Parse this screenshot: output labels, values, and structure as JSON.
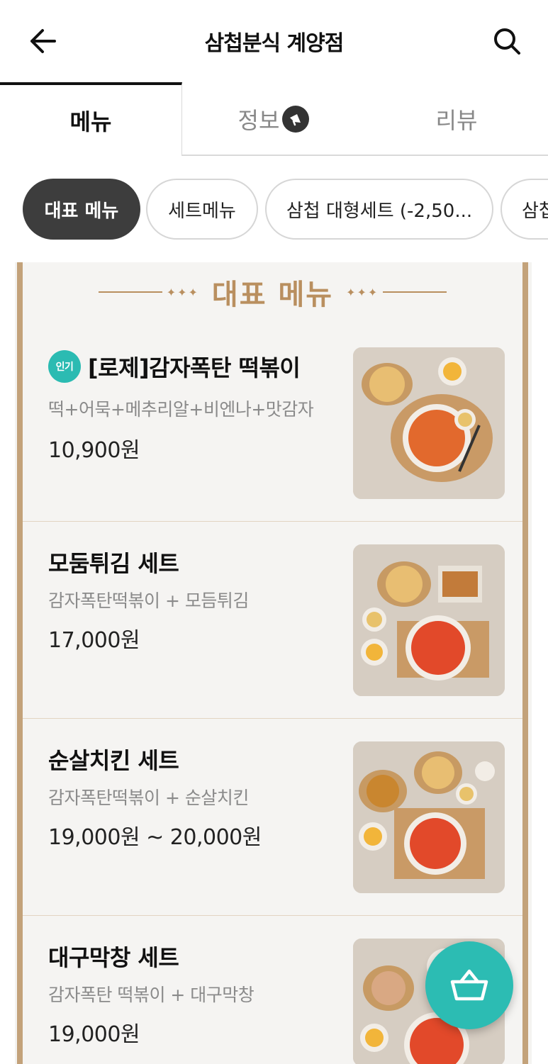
{
  "header": {
    "title": "삼첩분식 계양점"
  },
  "tabs": [
    {
      "label": "메뉴"
    },
    {
      "label": "정보"
    },
    {
      "label": "리뷰"
    }
  ],
  "chips": [
    {
      "label": "대표 메뉴"
    },
    {
      "label": "세트메뉴"
    },
    {
      "label": "삼첩 대형세트 (-2,50..."
    },
    {
      "label": "삼첩"
    }
  ],
  "section": {
    "title": "대표 메뉴"
  },
  "items": [
    {
      "badge": "인기",
      "name": "[로제]감자폭탄 떡볶이",
      "desc": "떡+어묵+메추리알+비엔나+맛감자",
      "price": "10,900원"
    },
    {
      "name": "모둠튀김 세트",
      "desc": "감자폭탄떡볶이 + 모듬튀김",
      "price": "17,000원"
    },
    {
      "name": "순살치킨 세트",
      "desc": "감자폭탄떡볶이 + 순살치킨",
      "price": "19,000원 ~ 20,000원"
    },
    {
      "name": "대구막창 세트",
      "desc": "감자폭탄 떡볶이 + 대구막창",
      "price": "19,000원"
    }
  ],
  "colors": {
    "accent": "#2cbcb3",
    "board_gold": "#c3a27a",
    "chip_active": "#3d3d3d"
  },
  "icons": {
    "back": "arrow-left-icon",
    "search": "search-icon",
    "info": "megaphone-icon",
    "cart": "basket-icon"
  }
}
